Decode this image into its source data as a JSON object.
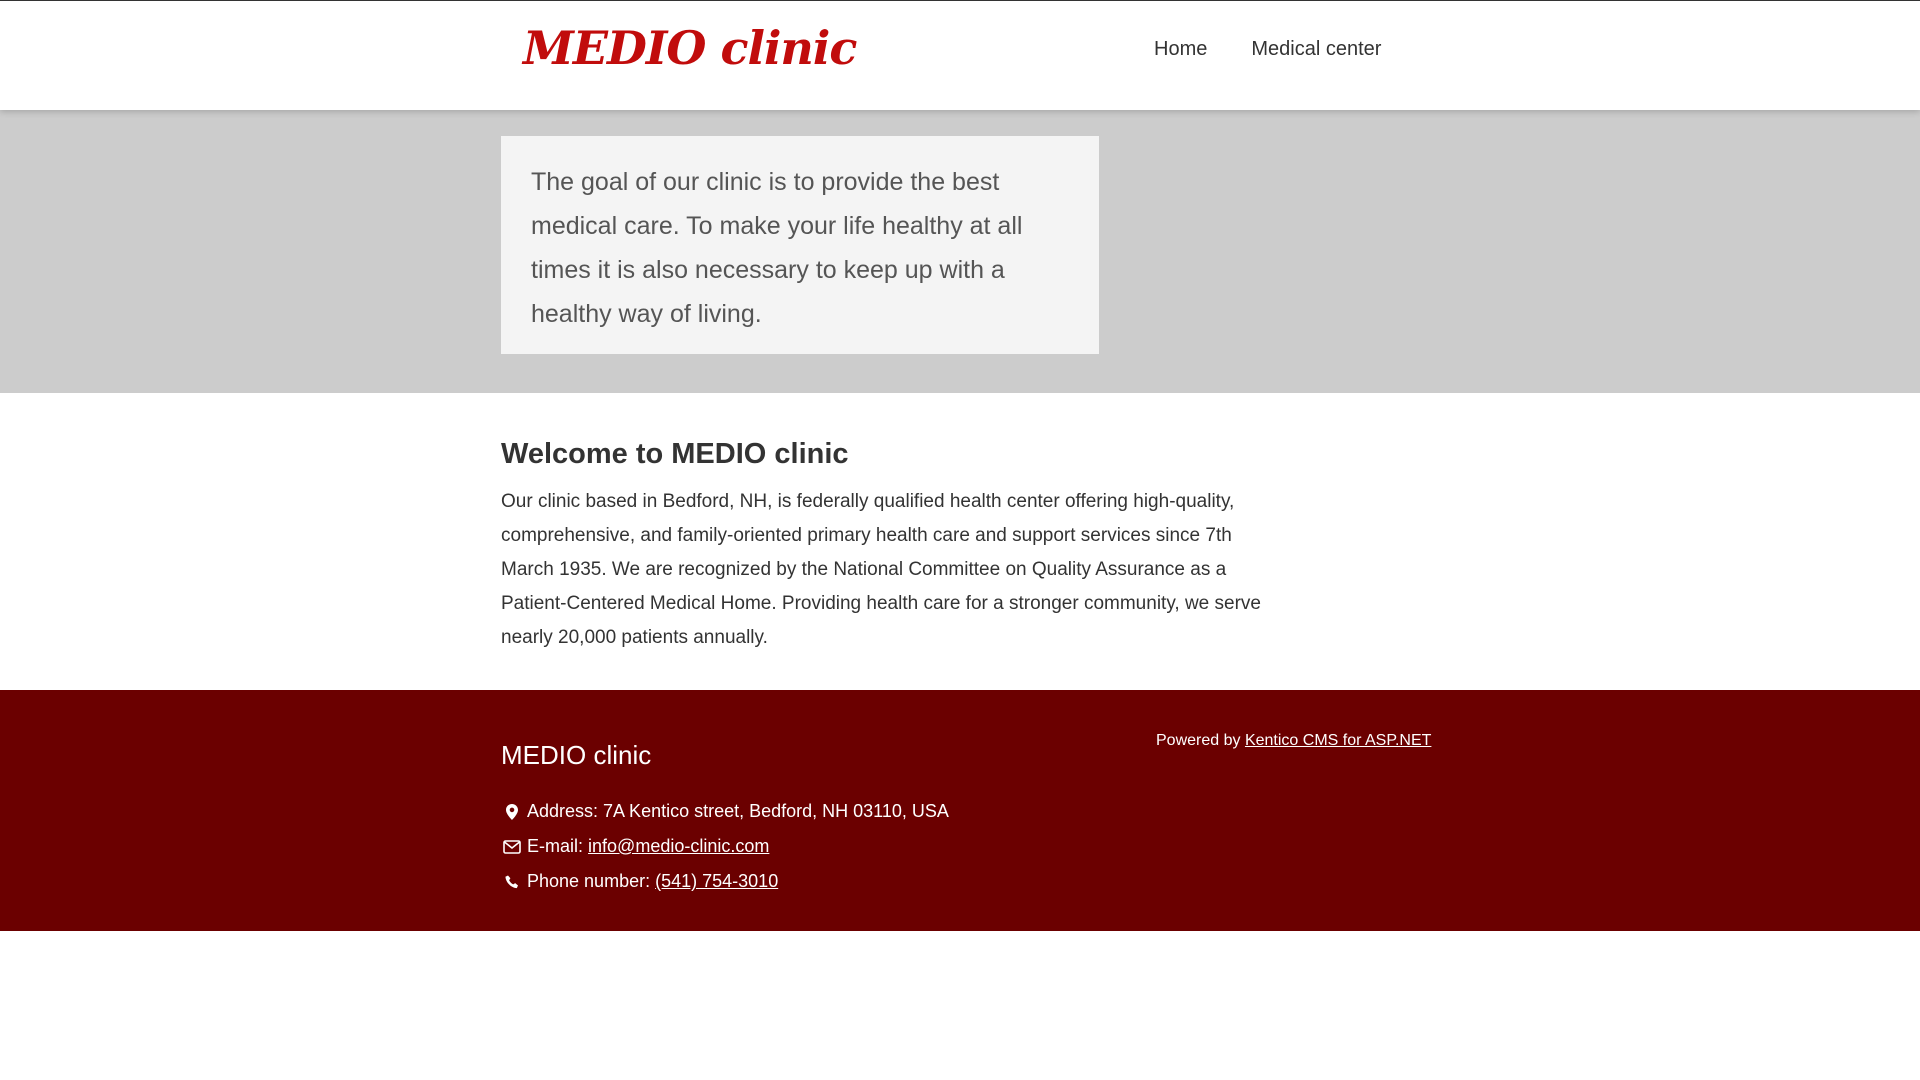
{
  "header": {
    "logo": "MEDIO clinic",
    "nav": [
      {
        "label": "Home"
      },
      {
        "label": "Medical center"
      }
    ]
  },
  "hero": {
    "text": "The goal of our clinic is to provide the best medical care. To make your life healthy at all times it is also necessary to keep up with a healthy way of living."
  },
  "main": {
    "title": "Welcome to MEDIO clinic",
    "body": "Our clinic based in Bedford, NH, is federally qualified health center offering high-quality, comprehensive, and family-oriented primary health care and support services since 7th March 1935. We are recognized by the National Committee on Quality Assurance as a Patient-Centered Medical Home. Providing health care for a stronger community, we serve nearly 20,000 patients annually."
  },
  "footer": {
    "title": "MEDIO clinic",
    "address_label": "Address: 7A Kentico street, Bedford, NH 03110, USA",
    "email_label": "E-mail:",
    "email": "info@medio-clinic.com",
    "phone_label": "Phone number:",
    "phone": "(541) 754-3010",
    "powered_label": "Powered by",
    "powered_link": "Kentico CMS for ASP.NET",
    "icons": [
      "map-marker-icon",
      "envelope-icon",
      "phone-icon"
    ]
  },
  "colors": {
    "brand": "#c10c0c",
    "hero_bg": "#cccccc",
    "hero_box": "#f4f4f4",
    "footer_bg": "#6b0000"
  }
}
